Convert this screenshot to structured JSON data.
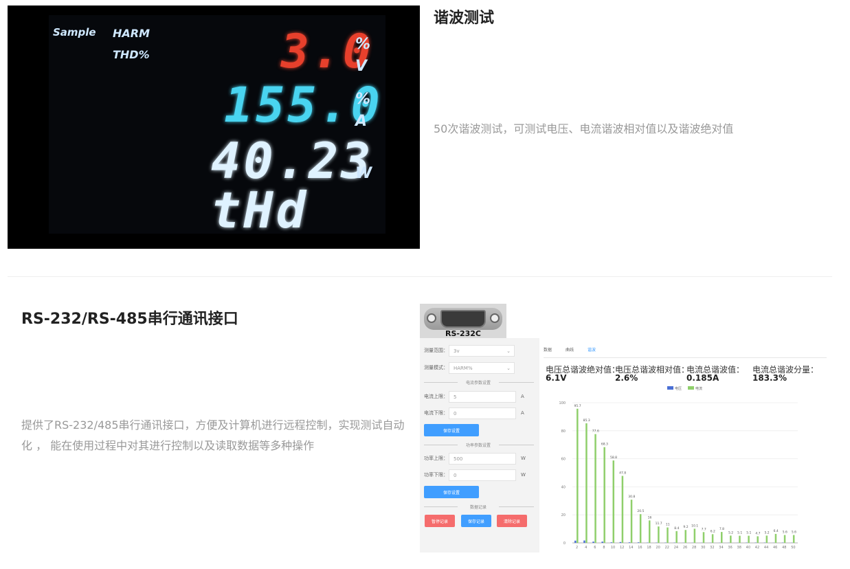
{
  "section1": {
    "title": "谐波测试",
    "description": "50次谐波测试，可测试电压、电流谐波相对值以及谐波绝对值",
    "display": {
      "label_sample": "Sample",
      "label_harm": "HARM",
      "label_thd": "THD%",
      "row1": {
        "value": "3.0",
        "unit_top": "%",
        "unit_bottom": "V",
        "color": "#e8402c"
      },
      "row2": {
        "value": "155.0",
        "unit_top": "%",
        "unit_bottom": "A",
        "color": "#49d4f0"
      },
      "row3": {
        "value": "40.23",
        "unit": "W",
        "color": "#dff2ff"
      },
      "row4": {
        "value": "tHd",
        "color": "#dff2ff"
      }
    }
  },
  "section2": {
    "title": "RS-232/RS-485串行通讯接口",
    "description": "提供了RS-232/485串行通讯接口，方便及计算机进行远程控制，实现测试自动化 ， 能在使用过程中对其进行控制以及读取数据等多种操作",
    "connector_label": "RS-232C",
    "panel": {
      "range_label": "测量范围：",
      "range_value": "3v",
      "mode_label": "测量模式：",
      "mode_value": "HARM%",
      "current_section": "电流参数设置",
      "current_upper_label": "电流上限：",
      "current_upper_value": "5",
      "current_lower_label": "电流下限：",
      "current_lower_value": "0",
      "current_unit": "A",
      "save_button": "保存设置",
      "power_section": "功率参数设置",
      "power_upper_label": "功率上限：",
      "power_upper_value": "500",
      "power_lower_label": "功率下限：",
      "power_lower_value": "0",
      "power_unit": "W",
      "save_button2": "保存设置",
      "record_section": "数据记录",
      "btn_pause": "暂停记录",
      "btn_save": "保存记录",
      "btn_clear": "清除记录"
    },
    "tabs": [
      "数据",
      "曲线",
      "谐波"
    ],
    "active_tab": "谐波",
    "stats": [
      {
        "label": "电压总谐波绝对值：",
        "value": "6.1V"
      },
      {
        "label": "电压总谐波相对值：",
        "value": "2.6%"
      },
      {
        "label": "电流总谐波值：",
        "value": "0.185A"
      },
      {
        "label": "电流总谐波分量：",
        "value": "183.3%"
      }
    ]
  },
  "chart_data": {
    "type": "bar",
    "legend": [
      "电压",
      "电流"
    ],
    "legend_colors": [
      "#4a6fd4",
      "#8fcf6b"
    ],
    "ylim": [
      0,
      100
    ],
    "yticks": [
      0,
      20,
      40,
      60,
      80,
      100
    ],
    "categories": [
      2,
      4,
      6,
      8,
      10,
      12,
      14,
      16,
      18,
      20,
      22,
      24,
      26,
      28,
      30,
      32,
      34,
      36,
      38,
      40,
      42,
      44,
      46,
      48,
      50
    ],
    "series": [
      {
        "name": "电压",
        "values": [
          1.6,
          1.7,
          0.9,
          0.9,
          0.4,
          0.6,
          0.4,
          0.4,
          0.2,
          0.2,
          0.2,
          0.2,
          0.1,
          0.1,
          0.1,
          0.1,
          0.1,
          0.1,
          0.1,
          0.2,
          0.2,
          0.2,
          0.1,
          0.2,
          0.1
        ]
      },
      {
        "name": "电流",
        "values": [
          95.7,
          85.3,
          77.6,
          68.3,
          58.8,
          47.8,
          30.8,
          20.5,
          16.0,
          11.7,
          11.0,
          8.4,
          9.2,
          10.1,
          7.7,
          6.2,
          7.8,
          5.2,
          5.1,
          5.1,
          4.7,
          5.2,
          6.4,
          5.6,
          5.6
        ]
      }
    ],
    "value_labels": [
      "95.7",
      "85.3",
      "77.6",
      "68.3",
      "58.8",
      "47.8",
      "30.8",
      "20.5",
      "16",
      "11.7",
      "11",
      "8.4",
      "9.2",
      "10.1",
      "7.7",
      "6.2",
      "7.8",
      "5.2",
      "5.1",
      "5.1",
      "4.7",
      "5.2",
      "6.4",
      "5.6",
      "5.6"
    ]
  }
}
